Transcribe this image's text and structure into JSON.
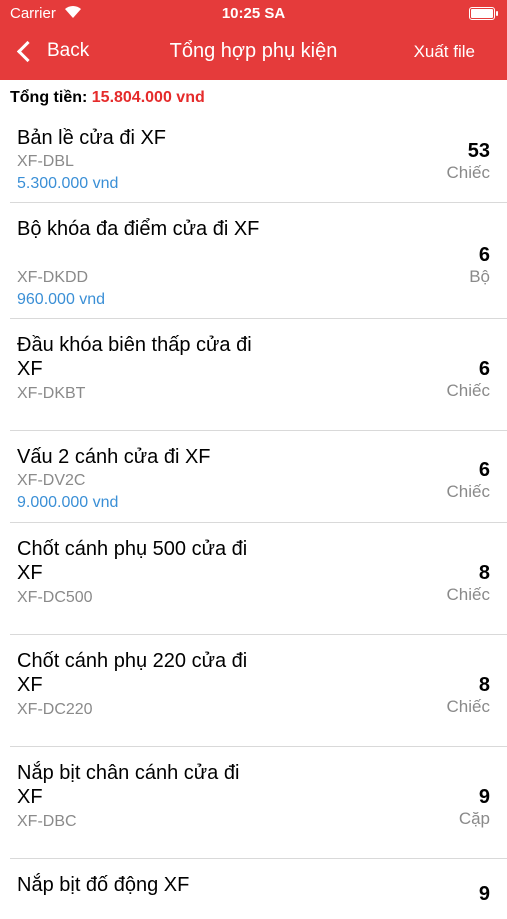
{
  "status_bar": {
    "carrier": "Carrier",
    "time": "10:25 SA"
  },
  "nav": {
    "back_label": "Back",
    "title": "Tổng hợp phụ kiện",
    "export_label": "Xuất file"
  },
  "summary": {
    "total_label": "Tổng tiền:",
    "total_amount": "15.804.000 vnd"
  },
  "items": [
    {
      "name": "Bản lề cửa đi XF",
      "code": "XF-DBL",
      "price": "5.300.000 vnd",
      "qty": "53",
      "unit": "Chiếc"
    },
    {
      "name": "Bộ khóa đa điểm cửa đi XF",
      "code": "XF-DKDD",
      "price": "960.000 vnd",
      "qty": "6",
      "unit": "Bộ"
    },
    {
      "name": "Đầu khóa biên thấp cửa đi XF",
      "code": "XF-DKBT",
      "price": "",
      "qty": "6",
      "unit": "Chiếc"
    },
    {
      "name": "Vấu 2 cánh cửa đi XF",
      "code": "XF-DV2C",
      "price": "9.000.000 vnd",
      "qty": "6",
      "unit": "Chiếc"
    },
    {
      "name": "Chốt cánh phụ 500 cửa đi XF",
      "code": "XF-DC500",
      "price": "",
      "qty": "8",
      "unit": "Chiếc"
    },
    {
      "name": "Chốt cánh phụ 220 cửa đi XF",
      "code": "XF-DC220",
      "price": "",
      "qty": "8",
      "unit": "Chiếc"
    },
    {
      "name": "Nắp bịt chân cánh cửa đi XF",
      "code": "XF-DBC",
      "price": "",
      "qty": "9",
      "unit": "Cặp"
    },
    {
      "name": "Nắp bịt đố động XF",
      "code": "",
      "price": "",
      "qty": "9",
      "unit": ""
    }
  ],
  "colors": {
    "header": "#e53b3b",
    "total_amount": "#e52b2b",
    "price": "#3a8fd6"
  }
}
